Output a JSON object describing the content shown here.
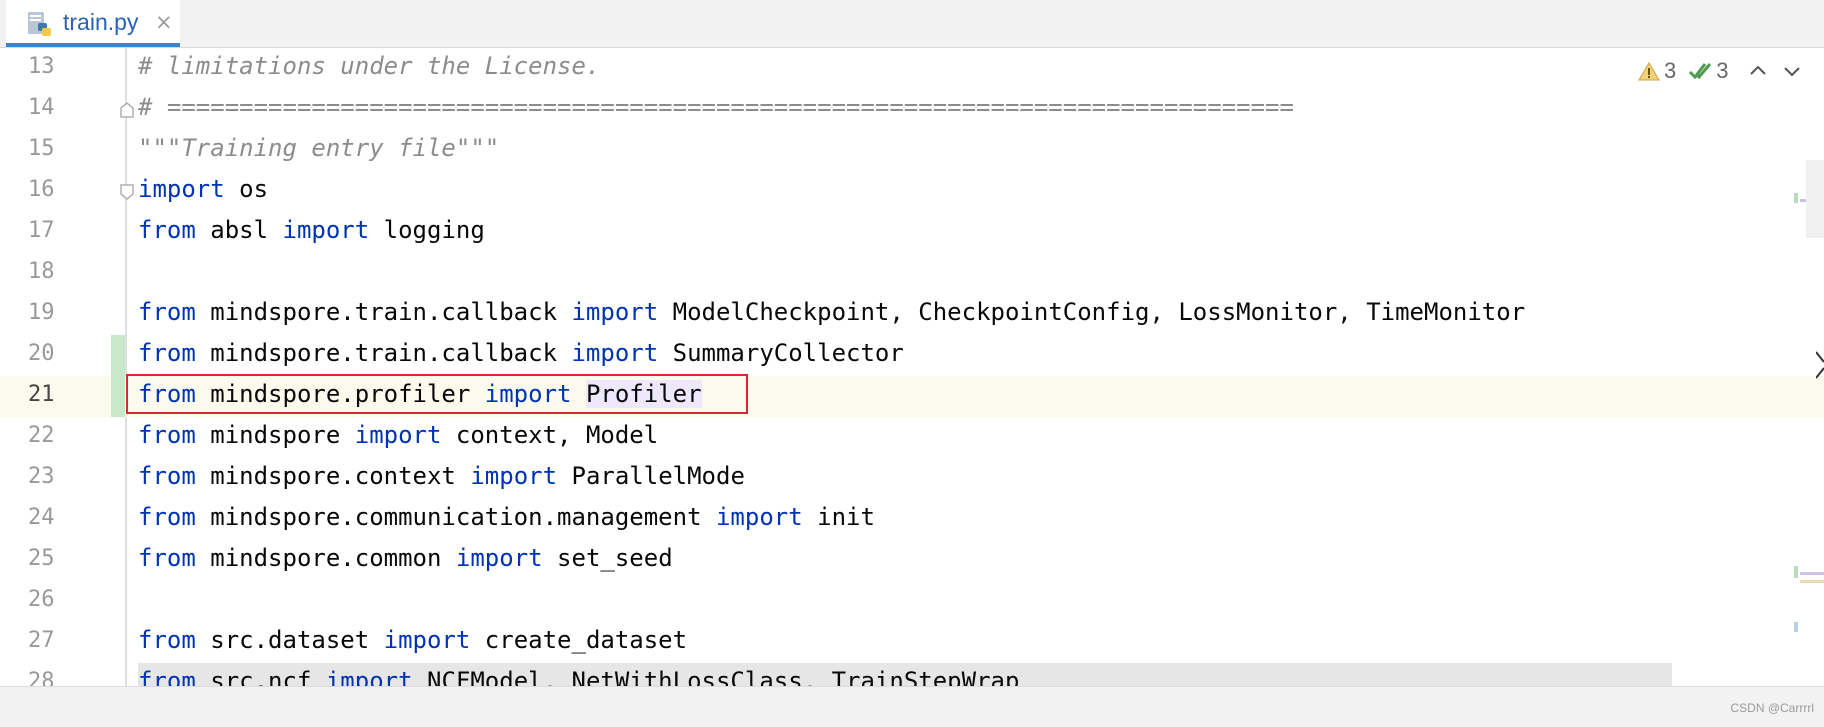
{
  "tab": {
    "label": "train.py",
    "close": "×",
    "icon": "python-file-icon"
  },
  "inspections": {
    "warnings": "3",
    "checks": "3"
  },
  "watermark": "CSDN @Carrrrl",
  "lines": [
    {
      "no": "13",
      "code": [
        {
          "t": "# limitations under the License.",
          "c": "cm"
        }
      ]
    },
    {
      "no": "14",
      "code": [
        {
          "t": "# ==============================================================================",
          "c": "cm"
        }
      ]
    },
    {
      "no": "15",
      "code": [
        {
          "t": "\"\"\"Training entry file\"\"\"",
          "c": "st"
        }
      ]
    },
    {
      "no": "16",
      "code": [
        {
          "t": "import",
          "c": "kw"
        },
        {
          "t": " os"
        }
      ]
    },
    {
      "no": "17",
      "code": [
        {
          "t": "from",
          "c": "kw"
        },
        {
          "t": " absl "
        },
        {
          "t": "import",
          "c": "kw"
        },
        {
          "t": " logging"
        }
      ]
    },
    {
      "no": "18",
      "code": []
    },
    {
      "no": "19",
      "code": [
        {
          "t": "from",
          "c": "kw"
        },
        {
          "t": " mindspore.train.callback "
        },
        {
          "t": "import",
          "c": "kw"
        },
        {
          "t": " ModelCheckpoint, CheckpointConfig, LossMonitor, TimeMonitor"
        }
      ]
    },
    {
      "no": "20",
      "code": [
        {
          "t": "from",
          "c": "kw"
        },
        {
          "t": " mindspore.train.callback "
        },
        {
          "t": "import",
          "c": "kw"
        },
        {
          "t": " SummaryCollector"
        }
      ]
    },
    {
      "no": "21",
      "code": [
        {
          "t": "from",
          "c": "kw"
        },
        {
          "t": " mindspore.profiler "
        },
        {
          "t": "import",
          "c": "kw"
        },
        {
          "t": " "
        },
        {
          "t": "Profiler",
          "c": "hl"
        }
      ]
    },
    {
      "no": "22",
      "code": [
        {
          "t": "from",
          "c": "kw"
        },
        {
          "t": " mindspore "
        },
        {
          "t": "import",
          "c": "kw"
        },
        {
          "t": " context, Model"
        }
      ]
    },
    {
      "no": "23",
      "code": [
        {
          "t": "from",
          "c": "kw"
        },
        {
          "t": " mindspore.context "
        },
        {
          "t": "import",
          "c": "kw"
        },
        {
          "t": " ParallelMode"
        }
      ]
    },
    {
      "no": "24",
      "code": [
        {
          "t": "from",
          "c": "kw"
        },
        {
          "t": " mindspore.communication.management "
        },
        {
          "t": "import",
          "c": "kw"
        },
        {
          "t": " init"
        }
      ]
    },
    {
      "no": "25",
      "code": [
        {
          "t": "from",
          "c": "kw"
        },
        {
          "t": " mindspore.common "
        },
        {
          "t": "import",
          "c": "kw"
        },
        {
          "t": " set_seed"
        }
      ]
    },
    {
      "no": "26",
      "code": []
    },
    {
      "no": "27",
      "code": [
        {
          "t": "from",
          "c": "kw"
        },
        {
          "t": " src.dataset "
        },
        {
          "t": "import",
          "c": "kw"
        },
        {
          "t": " create_dataset"
        }
      ]
    },
    {
      "no": "28",
      "code": [
        {
          "t": "from",
          "c": "kw"
        },
        {
          "t": " src.ncf "
        },
        {
          "t": "import",
          "c": "kw"
        },
        {
          "t": " NCFModel, NetWithLossClass, TrainStepWrap"
        }
      ]
    }
  ]
}
